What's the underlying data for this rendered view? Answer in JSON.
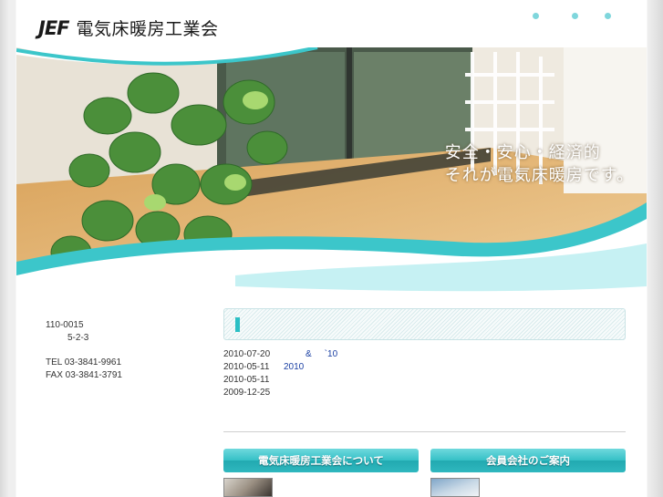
{
  "header": {
    "logo_mark": "JEF",
    "logo_name": "電気床暖房工業会"
  },
  "hero": {
    "tagline_line1": "安全・安心・経済的",
    "tagline_line2": "それが電気床暖房です。"
  },
  "address": {
    "postal": "110-0015",
    "street": "5-2-3",
    "tel": "TEL 03-3841-9961",
    "fax": "FAX 03-3841-3791"
  },
  "news": {
    "items": [
      {
        "date": "2010-07-20",
        "link_amp": "&",
        "link_tail": "`10"
      },
      {
        "date": "2010-05-11",
        "link_text": "2010"
      },
      {
        "date": "2010-05-11",
        "link_text": ""
      },
      {
        "date": "2009-12-25",
        "link_text": ""
      }
    ]
  },
  "nav": {
    "about_label": "電気床暖房工業会について",
    "members_label": "会員会社のご案内"
  },
  "colors": {
    "accent": "#2bbfc4",
    "link": "#1a3fa3"
  }
}
